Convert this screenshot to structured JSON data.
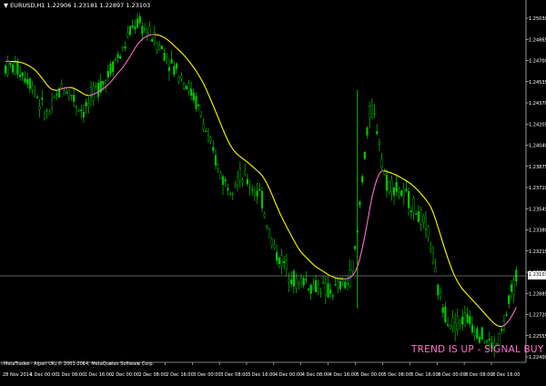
{
  "header": {
    "arrow": "▼",
    "symbol": "EURUSD,H1",
    "ohlc": "1.22906 1.23181 1.22897 1.23103"
  },
  "footer": {
    "copyright": "MetaTrader - Alpari UK, © 2001-2014, MetaQuotes Software Corp."
  },
  "signal": {
    "text": "TREND IS UP - SIGNAL BUY ⇧",
    "color": "#ff6ec7"
  },
  "price_axis": {
    "labels": [
      "1.25030",
      "1.24865",
      "1.24700",
      "1.24535",
      "1.24370",
      "1.24205",
      "1.24040",
      "1.23875",
      "1.23710",
      "1.23545",
      "1.23380",
      "1.23215",
      "1.23050",
      "1.22885",
      "1.22720",
      "1.22555",
      "1.22400"
    ],
    "current_price": "1.23103"
  },
  "time_axis": {
    "labels": [
      "28 Nov 2014",
      "1 Dec 00:00",
      "1 Dec 08:00",
      "1 Dec 16:00",
      "2 Dec 00:00",
      "2 Dec 08:00",
      "2 Dec 16:00",
      "3 Dec 00:00",
      "3 Dec 08:00",
      "3 Dec 16:00",
      "4 Dec 00:00",
      "4 Dec 08:00",
      "4 Dec 16:00",
      "5 Dec 00:00",
      "5 Dec 08:00",
      "5 Dec 16:00",
      "8 Dec 00:00",
      "8 Dec 08:00",
      "8 Dec 16:00"
    ]
  },
  "colors": {
    "background": "#000000",
    "bull_candle": "#00c800",
    "bear_candle": "#00c800",
    "trend_line": "#ffff00",
    "signal_line": "#ff6ec7",
    "grid_text": "#ffffff"
  },
  "chart_data": {
    "type": "candlestick",
    "symbol": "EURUSD",
    "timeframe": "H1",
    "ylim": [
      1.224,
      1.2515
    ],
    "prices": [
      1.247,
      1.2468,
      1.2462,
      1.2455,
      1.244,
      1.2432,
      1.2445,
      1.2455,
      1.245,
      1.244,
      1.2435,
      1.2448,
      1.2455,
      1.2462,
      1.2475,
      1.248,
      1.2495,
      1.2505,
      1.25,
      1.2495,
      1.2488,
      1.248,
      1.247,
      1.2465,
      1.2455,
      1.2445,
      1.243,
      1.241,
      1.2395,
      1.238,
      1.2378,
      1.2385,
      1.2382,
      1.2375,
      1.237,
      1.2345,
      1.2325,
      1.2318,
      1.231,
      1.23,
      1.2305,
      1.2298,
      1.23,
      1.2295,
      1.2296,
      1.23,
      1.2302,
      1.233,
      1.2395,
      1.244,
      1.242,
      1.238,
      1.2378,
      1.2372,
      1.2368,
      1.236,
      1.235,
      1.234,
      1.23,
      1.228,
      1.227,
      1.2272,
      1.2275,
      1.2268,
      1.2262,
      1.2255,
      1.2252,
      1.2265,
      1.229,
      1.231
    ]
  }
}
